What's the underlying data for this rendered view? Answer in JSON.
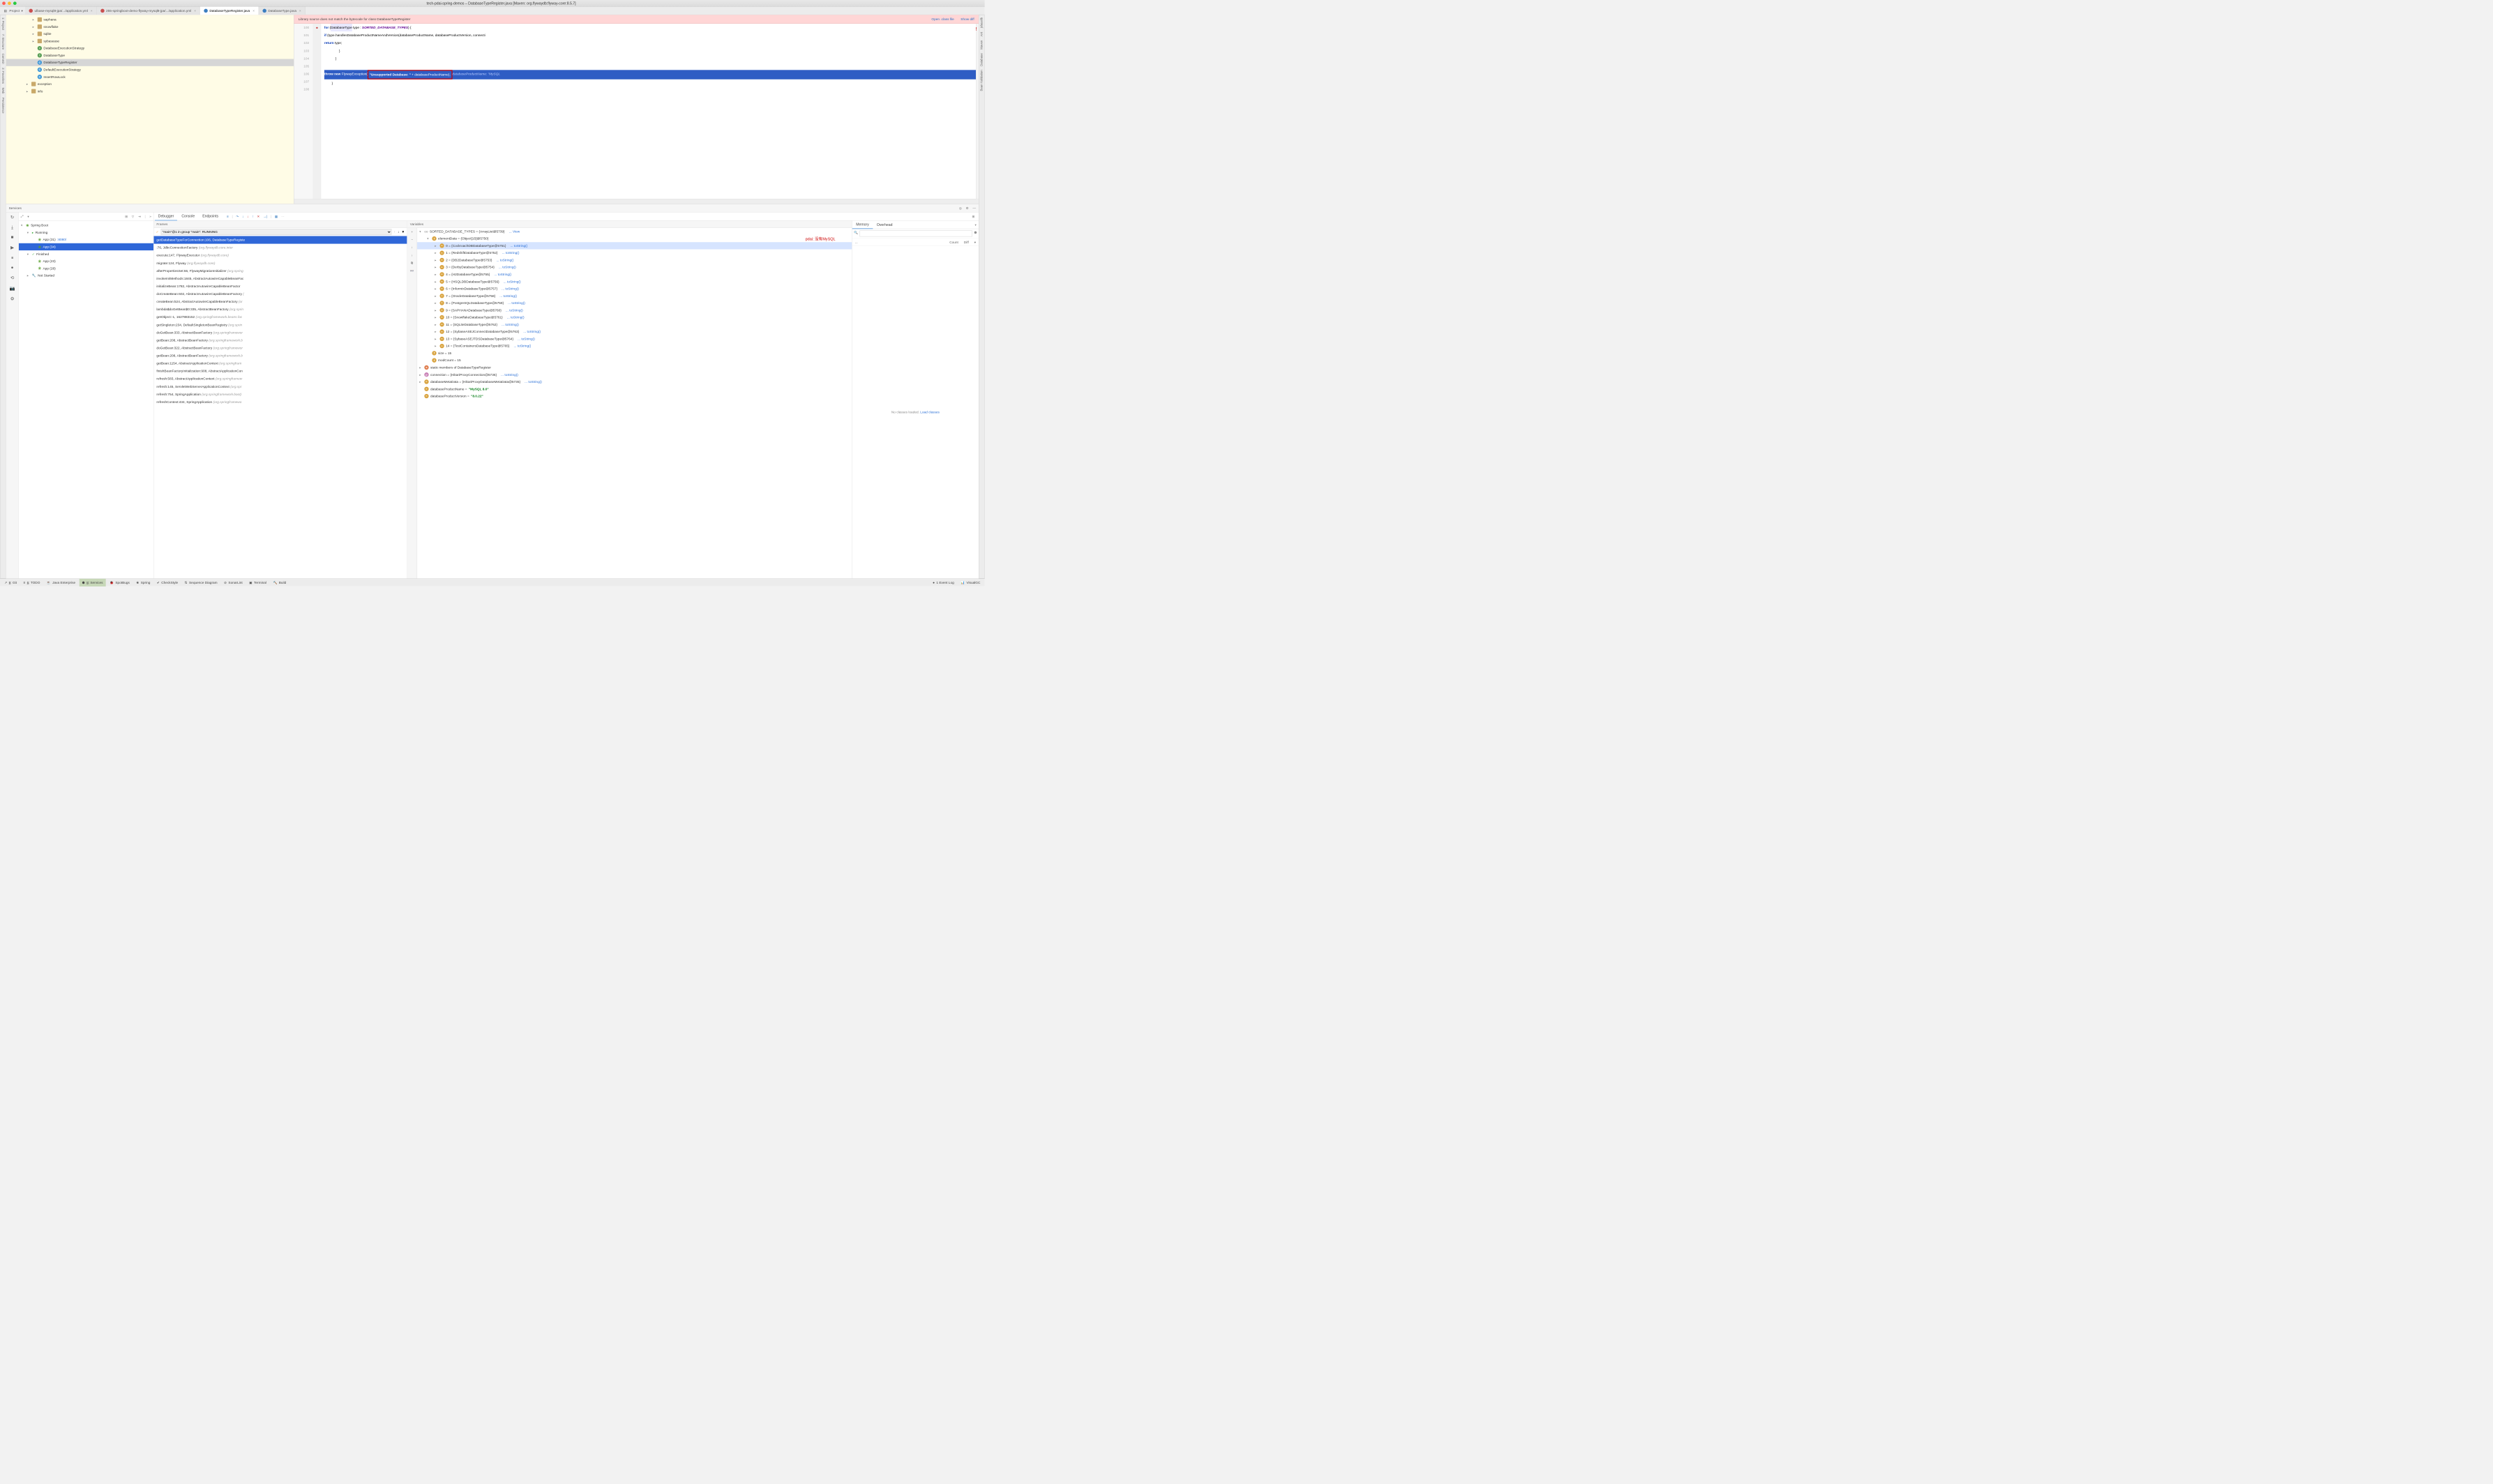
{
  "title": "tech-pdai-spring-demos – DatabaseTypeRegister.java [Maven: org.flywaydb:flyway-core:8.5.7]",
  "project_label": "Project",
  "editor_tabs": [
    {
      "label": "ulbase-mysql8-jpa/.../application.yml",
      "type": "yml",
      "active": false
    },
    {
      "label": "255-springboot-demo-flyway-mysql8-jpa/.../application.yml",
      "type": "yml",
      "active": false
    },
    {
      "label": "DatabaseTypeRegister.java",
      "type": "cls",
      "active": true
    },
    {
      "label": "DatabaseType.java",
      "type": "cls",
      "active": false
    }
  ],
  "tree": [
    {
      "indent": 4,
      "arrow": "▸",
      "ic": "folder",
      "label": "saphana"
    },
    {
      "indent": 4,
      "arrow": "▸",
      "ic": "folder",
      "label": "snowflake"
    },
    {
      "indent": 4,
      "arrow": "▸",
      "ic": "folder",
      "label": "sqlite"
    },
    {
      "indent": 4,
      "arrow": "▸",
      "ic": "folder",
      "label": "sybasease"
    },
    {
      "indent": 4,
      "arrow": "",
      "ic": "i",
      "label": "DatabaseExecutionStrategy"
    },
    {
      "indent": 4,
      "arrow": "",
      "ic": "i",
      "label": "DatabaseType"
    },
    {
      "indent": 4,
      "arrow": "",
      "ic": "c",
      "label": "DatabaseTypeRegister",
      "selected": true
    },
    {
      "indent": 4,
      "arrow": "",
      "ic": "c",
      "label": "DefaultExecutionStrategy"
    },
    {
      "indent": 4,
      "arrow": "",
      "ic": "c",
      "label": "InsertRowLock"
    },
    {
      "indent": 3,
      "arrow": "▸",
      "ic": "folder",
      "label": "exception"
    },
    {
      "indent": 3,
      "arrow": "▸",
      "ic": "folder",
      "label": "info"
    }
  ],
  "banner": {
    "msg": "Library source does not match the bytecode for class DatabaseTypeRegister",
    "a1": "Open .class file",
    "a2": "Show diff"
  },
  "code": {
    "lines": [
      {
        "n": 100,
        "html": "            <span class='kw'>for</span> (<span class='hl'>DatabaseType</span> type : <span class='str' style='color:#600090;font-style:italic'>SORTED_DATABASE_TYPES</span>) {"
      },
      {
        "n": 101,
        "html": "                <span class='kw'>if</span> (type.handlesDatabaseProductNameAndVersion(databaseProductName, databaseProductVersion, connecti"
      },
      {
        "n": 102,
        "html": "                    <span class='kw'>return</span> type;"
      },
      {
        "n": 103,
        "html": "                }"
      },
      {
        "n": 104,
        "html": "            }"
      },
      {
        "n": 105,
        "html": ""
      },
      {
        "n": 106,
        "exec": true,
        "bp": true,
        "html": "            <span class='kw'>throw new</span> FlywayException(<span class='redbox'><span class='str'>\"Unsupported Database: \"</span> + databaseProductName);</span>  <span class='ghost'>databaseProductName: \"MySQL</span>"
      },
      {
        "n": 107,
        "html": "        }"
      },
      {
        "n": 108,
        "html": ""
      }
    ]
  },
  "services_label": "Services",
  "svc_left_icons": [
    "↻",
    "⤓",
    "■",
    "▶",
    "⏸",
    "●",
    "⟲",
    "📷",
    "⚙"
  ],
  "svc_tree": [
    {
      "indent": 0,
      "arrow": "▾",
      "ic": "sb",
      "label": "Spring Boot"
    },
    {
      "indent": 1,
      "arrow": "▾",
      "ic": "run",
      "label": "Running"
    },
    {
      "indent": 2,
      "arrow": "",
      "ic": "sb",
      "label": "App (31)",
      "port": ":8080/"
    },
    {
      "indent": 2,
      "arrow": "",
      "ic": "sb",
      "label": "App (34)",
      "sel": true
    },
    {
      "indent": 1,
      "arrow": "▾",
      "ic": "fin",
      "label": "Finished"
    },
    {
      "indent": 2,
      "arrow": "",
      "ic": "sb",
      "label": "App (23)"
    },
    {
      "indent": 2,
      "arrow": "",
      "ic": "sb",
      "label": "App (28)"
    },
    {
      "indent": 1,
      "arrow": "▸",
      "ic": "ns",
      "label": "Not Started"
    }
  ],
  "dbg_tabs": [
    {
      "l": "Debugger",
      "act": true
    },
    {
      "l": "Console"
    },
    {
      "l": "Endpoints"
    }
  ],
  "frames_label": "Frames",
  "vars_label": "Variables",
  "thread": "\"main\"@1 in group \"main\": RUNNING",
  "frames": [
    {
      "t": "getDatabaseTypeForConnection:106, DatabaseTypeRegiste",
      "sel": true
    },
    {
      "t": "<init>:76, JdbcConnectionFactory ",
      "loc": "(org.flywaydb.core.inter"
    },
    {
      "t": "execute:147, FlywayExecutor ",
      "loc": "(org.flywaydb.core)"
    },
    {
      "t": "migrate:124, Flyway ",
      "loc": "(org.flywaydb.core)"
    },
    {
      "t": "afterPropertiesSet:66, FlywayMigrationInitializer ",
      "loc": "(org.spring"
    },
    {
      "t": "invokeInitMethods:1845, AbstractAutowireCapableBeanFac"
    },
    {
      "t": "initializeBean:1782, AbstractAutowireCapableBeanFactor"
    },
    {
      "t": "doCreateBean:602, AbstractAutowireCapableBeanFactory ",
      "loc": "("
    },
    {
      "t": "createBean:524, AbstractAutowireCapableBeanFactory ",
      "loc": "(or"
    },
    {
      "t": "lambda$doGetBean$0:335, AbstractBeanFactory ",
      "loc": "(org.sprin"
    },
    {
      "t": "getObject:-1, 1627883152 ",
      "loc": "(org.springframework.beans.fac"
    },
    {
      "t": "getSingleton:234, DefaultSingletonBeanRegistry ",
      "loc": "(org.sprin"
    },
    {
      "t": "doGetBean:333, AbstractBeanFactory ",
      "loc": "(org.springframewor"
    },
    {
      "t": "getBean:208, AbstractBeanFactory ",
      "loc": "(org.springframework.b"
    },
    {
      "t": "doGetBean:322, AbstractBeanFactory ",
      "loc": "(org.springframewor"
    },
    {
      "t": "getBean:208, AbstractBeanFactory ",
      "loc": "(org.springframework.b"
    },
    {
      "t": "getBean:1154, AbstractApplicationContext ",
      "loc": "(org.springfram"
    },
    {
      "t": "finishBeanFactoryInitialization:908, AbstractApplicationCon"
    },
    {
      "t": "refresh:583, AbstractApplicationContext ",
      "loc": "(org.springframew"
    },
    {
      "t": "refresh:145, ServletWebServerApplicationContext ",
      "loc": "(org.spr"
    },
    {
      "t": "refresh:754, SpringApplication ",
      "loc": "(org.springframework.boot)"
    },
    {
      "t": "refreshContext:434, SpringApplication ",
      "loc": "(org.springframewo"
    }
  ],
  "vars": [
    {
      "indent": 0,
      "arrow": "▾",
      "ic": "",
      "pre": "oo",
      "label": "SORTED_DATABASE_TYPES = {ArrayList@5739}",
      "link": "... View"
    },
    {
      "indent": 1,
      "arrow": "▾",
      "ic": "f",
      "label": "elementData = {Object[15]@5750}"
    },
    {
      "indent": 2,
      "arrow": "▸",
      "ic": "idx",
      "label": "0 = {CockroachDBDatabaseType@5751}",
      "link": "... toString()",
      "sel": true
    },
    {
      "indent": 2,
      "arrow": "▸",
      "ic": "idx",
      "label": "1 = {RedshiftDatabaseType@5752}",
      "link": "... toString()"
    },
    {
      "indent": 2,
      "arrow": "▸",
      "ic": "idx",
      "label": "2 = {DB2DatabaseType@5753}",
      "link": "... toString()"
    },
    {
      "indent": 2,
      "arrow": "▸",
      "ic": "idx",
      "label": "3 = {DerbyDatabaseType@5754}",
      "link": "... toString()"
    },
    {
      "indent": 2,
      "arrow": "▸",
      "ic": "idx",
      "label": "4 = {H2DatabaseType@5755}",
      "link": "... toString()"
    },
    {
      "indent": 2,
      "arrow": "▸",
      "ic": "idx",
      "label": "5 = {HSQLDBDatabaseType@5756}",
      "link": "... toString()"
    },
    {
      "indent": 2,
      "arrow": "▸",
      "ic": "idx",
      "label": "6 = {InformixDatabaseType@5757}",
      "link": "... toString()"
    },
    {
      "indent": 2,
      "arrow": "▸",
      "ic": "idx",
      "label": "7 = {OracleDatabaseType@5758}",
      "link": "... toString()"
    },
    {
      "indent": 2,
      "arrow": "▸",
      "ic": "idx",
      "label": "8 = {PostgreSQLDatabaseType@5759}",
      "link": "... toString()"
    },
    {
      "indent": 2,
      "arrow": "▸",
      "ic": "idx",
      "label": "9 = {SAPHANADatabaseType@5760}",
      "link": "... toString()"
    },
    {
      "indent": 2,
      "arrow": "▸",
      "ic": "idx",
      "label": "10 = {SnowflakeDatabaseType@5761}",
      "link": "... toString()"
    },
    {
      "indent": 2,
      "arrow": "▸",
      "ic": "idx",
      "label": "11 = {SQLiteDatabaseType@5762}",
      "link": "... toString()"
    },
    {
      "indent": 2,
      "arrow": "▸",
      "ic": "idx",
      "label": "12 = {SybaseASEJConnectDatabaseType@5763}",
      "link": "... toString()"
    },
    {
      "indent": 2,
      "arrow": "▸",
      "ic": "idx",
      "label": "13 = {SybaseASEJTDSDatabaseType@5764}",
      "link": "... toString()"
    },
    {
      "indent": 2,
      "arrow": "▸",
      "ic": "idx",
      "label": "14 = {TestContainersDatabaseType@5765}",
      "link": "... toString()"
    },
    {
      "indent": 1,
      "arrow": "",
      "ic": "f",
      "label": "size = 15"
    },
    {
      "indent": 1,
      "arrow": "",
      "ic": "f",
      "label": "modCount = 15"
    },
    {
      "indent": 0,
      "arrow": "▸",
      "ic": "s",
      "label": "static members of DatabaseTypeRegister"
    },
    {
      "indent": 0,
      "arrow": "▸",
      "ic": "p",
      "label": "connection = {HikariProxyConnection@5736}",
      "link": "... toString()"
    },
    {
      "indent": 0,
      "arrow": "▸",
      "ic": "idx",
      "label": "databaseMetaData = {HikariProxyDatabaseMetaData@5735}",
      "link": "... toString()"
    },
    {
      "indent": 0,
      "arrow": "",
      "ic": "idx",
      "label": "databaseProductName = ",
      "str": "\"MySQL 8.0\""
    },
    {
      "indent": 0,
      "arrow": "",
      "ic": "idx",
      "label": "databaseProductVersion = ",
      "str": "\"8.0.22\""
    }
  ],
  "annotation": "pdai: 没有MySQL",
  "mem": {
    "t1": "Memory",
    "t2": "Overhead",
    "c1": "...",
    "c2": "Count",
    "c3": "Diff",
    "msg": "No classes loaded. ",
    "link": "Load classes"
  },
  "status": [
    {
      "l": "9: Git",
      "u": "9",
      "ic": "↗"
    },
    {
      "l": "6: TODO",
      "u": "6",
      "ic": "≡"
    },
    {
      "l": "Java Enterprise",
      "ic": "☕"
    },
    {
      "l": "8: Services",
      "u": "8",
      "ic": "⬢",
      "act": true
    },
    {
      "l": "SpotBugs",
      "ic": "🐞"
    },
    {
      "l": "Spring",
      "ic": "❀"
    },
    {
      "l": "CheckStyle",
      "ic": "✔"
    },
    {
      "l": "Sequence Diagram",
      "ic": "⇅"
    },
    {
      "l": "SonarLint",
      "ic": "⊘"
    },
    {
      "l": "Terminal",
      "ic": "▣"
    },
    {
      "l": "Build",
      "ic": "🔨"
    }
  ],
  "status_right": [
    {
      "l": "1 Event Log",
      "ic": "●"
    },
    {
      "l": "VisualGC",
      "ic": "📊"
    }
  ],
  "left_rail": [
    "1: Project",
    "7: Structure",
    "Commit",
    "2: Favorites",
    "Web",
    "Persistence"
  ],
  "right_rail": [
    "jclasslib",
    "Ant",
    "Maven",
    "Database",
    "Bean Validation"
  ]
}
